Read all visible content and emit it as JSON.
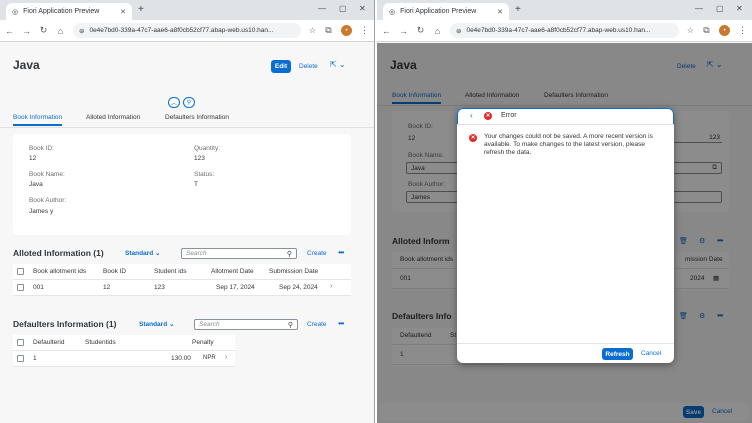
{
  "browser": {
    "tab_title": "Fiori Application Preview",
    "tab_close": "✕",
    "new_tab": "+",
    "url": "0e4e7bd0-339a-47c7-aae6-a8f0cb52cf77.abap-web.us10.han...",
    "avatar_initial": "•",
    "window_controls": [
      "—",
      "▢",
      "✕"
    ]
  },
  "left": {
    "page_title": "Java",
    "edit_label": "Edit",
    "delete_label": "Delete",
    "tabs": [
      "Book Information",
      "Alloted Information",
      "Defaulters Information"
    ],
    "fields": {
      "book_id_label": "Book ID:",
      "book_id_value": "12",
      "quantity_label": "Quantity:",
      "quantity_value": "123",
      "book_name_label": "Book Name:",
      "book_name_value": "Java",
      "status_label": "Status:",
      "status_value": "T",
      "book_author_label": "Book Author:",
      "book_author_value": "James y"
    },
    "alloted": {
      "title": "Alloted Information (1)",
      "variant": "Standard",
      "search_placeholder": "Search",
      "create_label": "Create",
      "columns": [
        "Book allotment ids",
        "Book ID",
        "Student ids",
        "Allotment Date",
        "Submission Date"
      ],
      "rows": [
        [
          "001",
          "12",
          "123",
          "Sep 17, 2024",
          "Sep 24, 2024"
        ]
      ]
    },
    "defaulters": {
      "title": "Defaulters Information (1)",
      "variant": "Standard",
      "search_placeholder": "Search",
      "create_label": "Create",
      "columns": [
        "Defaulterid",
        "Studentids",
        "Penalty"
      ],
      "rows": [
        [
          "1",
          "",
          "130.00",
          "NPR"
        ]
      ]
    }
  },
  "right": {
    "page_title": "Java",
    "delete_label": "Delete",
    "tabs": [
      "Book Information",
      "Alloted Information",
      "Defaulters Information"
    ],
    "fields": {
      "book_id_label": "Book ID:",
      "book_id_value": "12",
      "quantity_value": "123",
      "book_name_label": "Book Name:",
      "book_name_value": "Java",
      "book_author_label": "Book Author:",
      "book_author_value": "James"
    },
    "alloted": {
      "title": "Alloted Inform",
      "col_first": "Book allotment ids",
      "col_last": "mission Date",
      "row_first": "001",
      "row_date": "2024"
    },
    "defaulters": {
      "title": "Defaulters Info",
      "col_first": "Defaulterid",
      "col_second": "St",
      "row_first": "1"
    },
    "save_label": "Save",
    "cancel_label": "Cancel",
    "dialog": {
      "title": "Error",
      "message": "Your changes could not be saved. A more recent version is available. To make changes to the latest version, please refresh the data.",
      "refresh_label": "Refresh",
      "cancel_label": "Cancel"
    }
  },
  "colors": {
    "accent": "#0a6ed1",
    "error": "#e22a2a",
    "overlay": "rgba(0,0,0,0.45)"
  }
}
